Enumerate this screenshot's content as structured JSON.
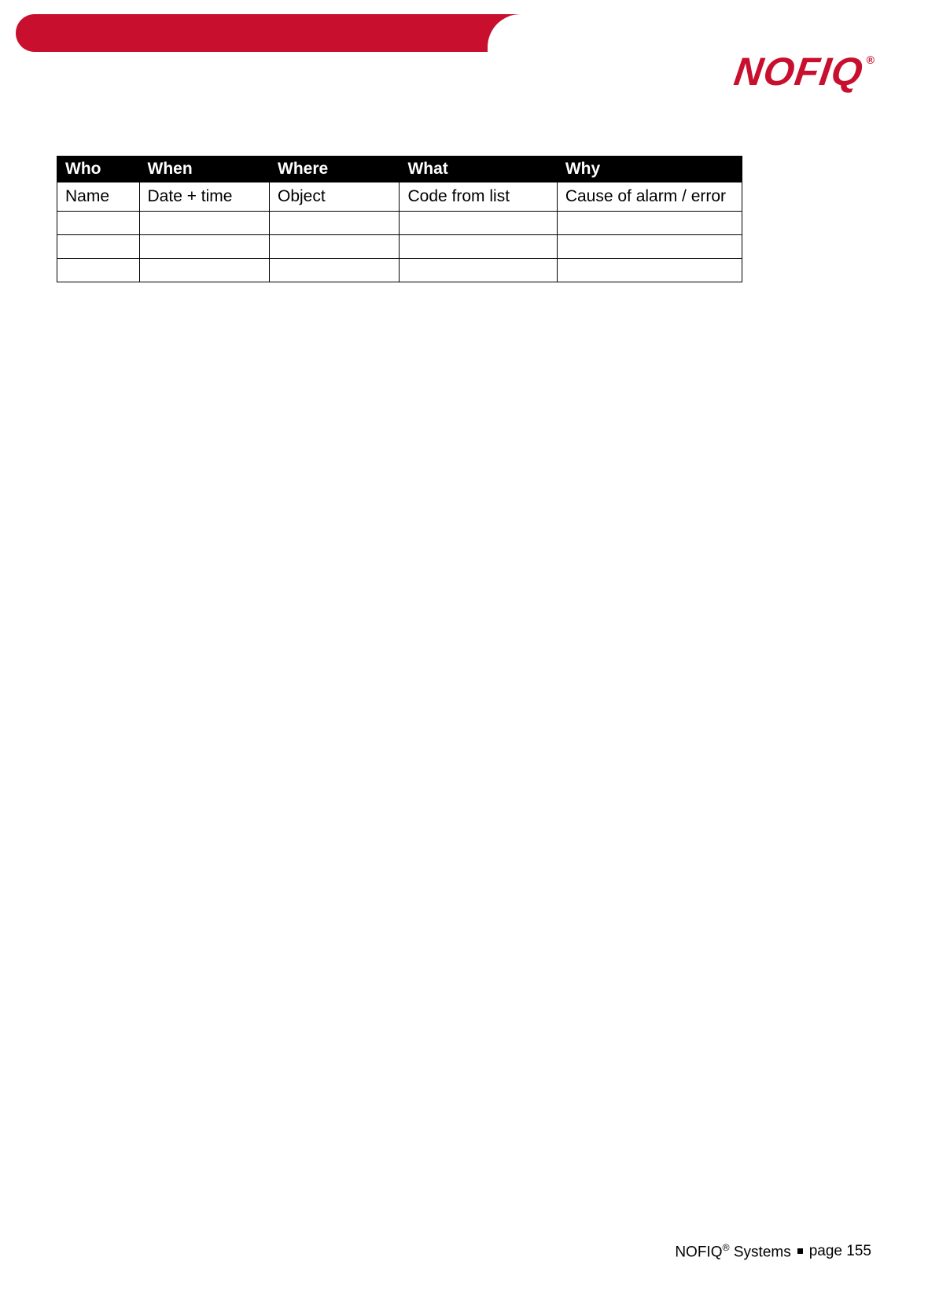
{
  "brand": {
    "logo_text": "NOFIQ",
    "registered_mark": "®",
    "accent_color": "#c8102e"
  },
  "table": {
    "headers": [
      "Who",
      "When",
      "Where",
      "What",
      "Why"
    ],
    "descriptor_row": [
      "Name",
      "Date + time",
      "Object",
      "Code from list",
      "Cause of alarm / error"
    ],
    "empty_rows": [
      [
        "",
        "",
        "",
        "",
        ""
      ],
      [
        "",
        "",
        "",
        "",
        ""
      ],
      [
        "",
        "",
        "",
        "",
        ""
      ]
    ]
  },
  "footer": {
    "brand": "NOFIQ",
    "reg": "®",
    "systems_label": "Systems",
    "page_label": "page",
    "page_number": "155"
  }
}
